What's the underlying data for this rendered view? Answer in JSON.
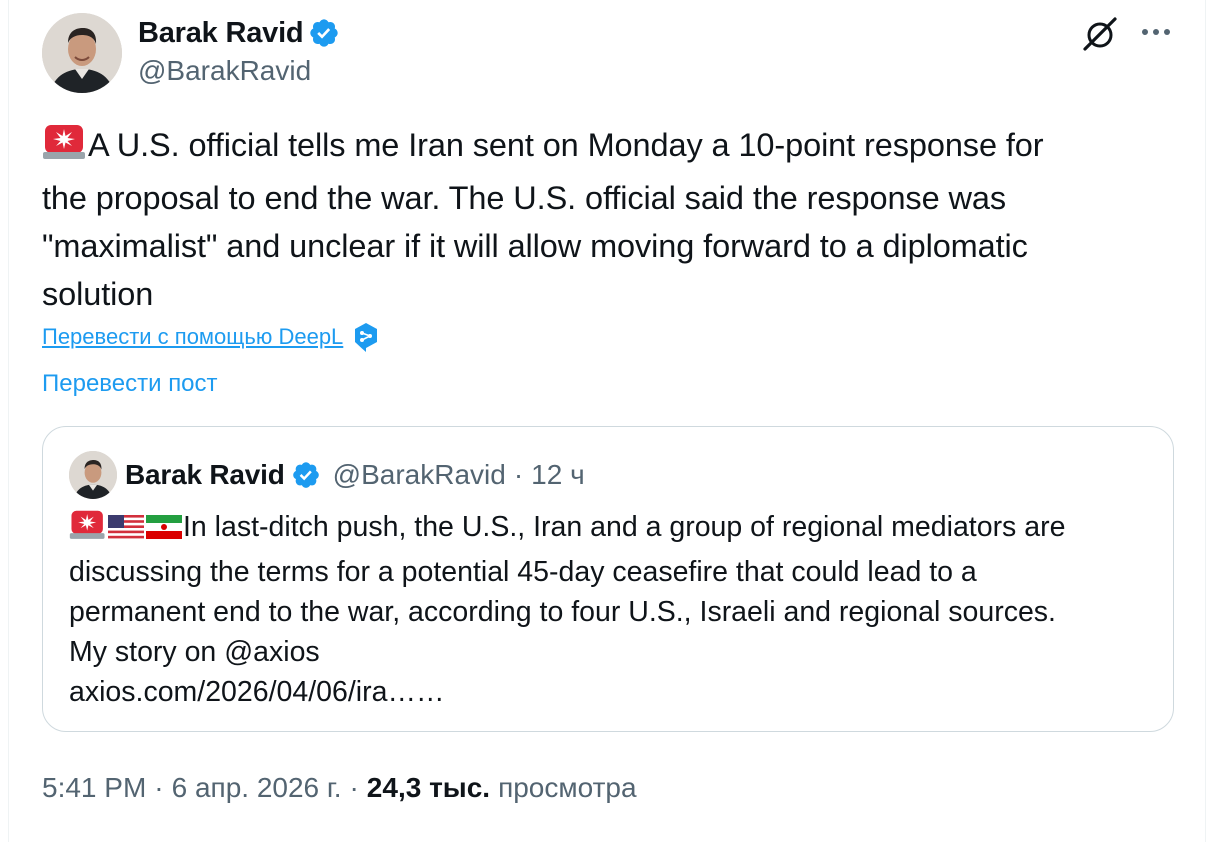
{
  "author": {
    "display_name": "Barak Ravid",
    "handle": "@BarakRavid",
    "verified": true
  },
  "tweet": {
    "siren_emoji": "🚨",
    "text_lines": [
      "A U.S. official tells me Iran sent on Monday a 10-point response for",
      "the proposal to end the war. The U.S. official said the response was",
      "\"maximalist\" and unclear if it will allow moving forward to a diplomatic",
      "solution"
    ]
  },
  "translate": {
    "deepl_label": "Перевести с помощью DeepL",
    "post_label": "Перевести пост"
  },
  "quote": {
    "display_name": "Barak Ravid",
    "handle": "@BarakRavid",
    "separator": "·",
    "time": "12 ч",
    "emojis": [
      "🚨",
      "🇺🇸",
      "🇮🇷"
    ],
    "text_lines": [
      "In last-ditch push, the U.S., Iran and a group of regional mediators are",
      "discussing the terms for a potential 45-day ceasefire that could lead to a",
      "permanent end to the war, according to four U.S., Israeli and regional sources.",
      "My story on @axios",
      "axios.com/2026/04/06/ira……"
    ]
  },
  "footer": {
    "time": "5:41 PM",
    "separator": "·",
    "date": "6 апр. 2026 г.",
    "views_count": "24,3 тыс.",
    "views_label": "просмотра"
  },
  "icons": {
    "grok": "grok-icon",
    "more": "more-horizontal-icon",
    "verified": "verified-badge-icon",
    "deepl": "deepl-icon"
  },
  "colors": {
    "accent": "#1d9bf0",
    "secondary_text": "#536471",
    "border": "#cfd9de"
  }
}
